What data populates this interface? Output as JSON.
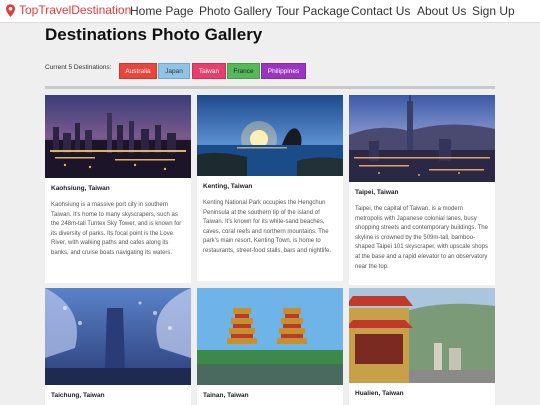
{
  "brand": {
    "name": "TopTravelDestination",
    "icon": "map-pin-icon",
    "color": "#e23b3b"
  },
  "nav": {
    "items": [
      "Home Page",
      "Photo Gallery",
      "Tour Package",
      "Contact Us",
      "About Us",
      "Sign Up"
    ]
  },
  "page": {
    "title": "Destinations Photo Gallery",
    "current_label": "Current 5 Destinations:"
  },
  "chips": [
    {
      "label": "Australia",
      "color": "#e8453c"
    },
    {
      "label": "Japan",
      "color": "#8fc4e6"
    },
    {
      "label": "Taiwan",
      "color": "#e83e6b"
    },
    {
      "label": "France",
      "color": "#57b85a"
    },
    {
      "label": "Philippines",
      "color": "#9b35c1"
    }
  ],
  "cards": [
    {
      "title": "Kaohsiung, Taiwan",
      "desc": "Kaohsiung is a massive port city in southern Taiwan. It's home to many skyscrapers, such as the 248m-tall Tuntex Sky Tower, and is known for its diversity of parks. Its focal point is the Love River, with walking paths and cafes along its banks, and cruise boats navigating its waters."
    },
    {
      "title": "Kenting, Taiwan",
      "desc": "Kenting National Park occupies the Hengchun Peninsula at the southern tip of the island of Taiwan. It's known for its white-sand beaches, caves, coral reefs and northern mountains. The park's main resort, Kenting Town, is home to restaurants, street-food stalls, bars and nightlife."
    },
    {
      "title": "Taipei, Taiwan",
      "desc": "Taipei, the capital of Taiwan, is a modern metropolis with Japanese colonial lanes, busy shopping streets and contemporary buildings. The skyline is crowned by the 509m-tall, bamboo-shaped Taipei 101 skyscraper, with upscale shops at the base and a rapid elevator to an observatory near the top."
    },
    {
      "title": "Taichung, Taiwan",
      "desc": ""
    },
    {
      "title": "Tainan, Taiwan",
      "desc": ""
    },
    {
      "title": "Hualien, Taiwan",
      "desc": ""
    }
  ]
}
